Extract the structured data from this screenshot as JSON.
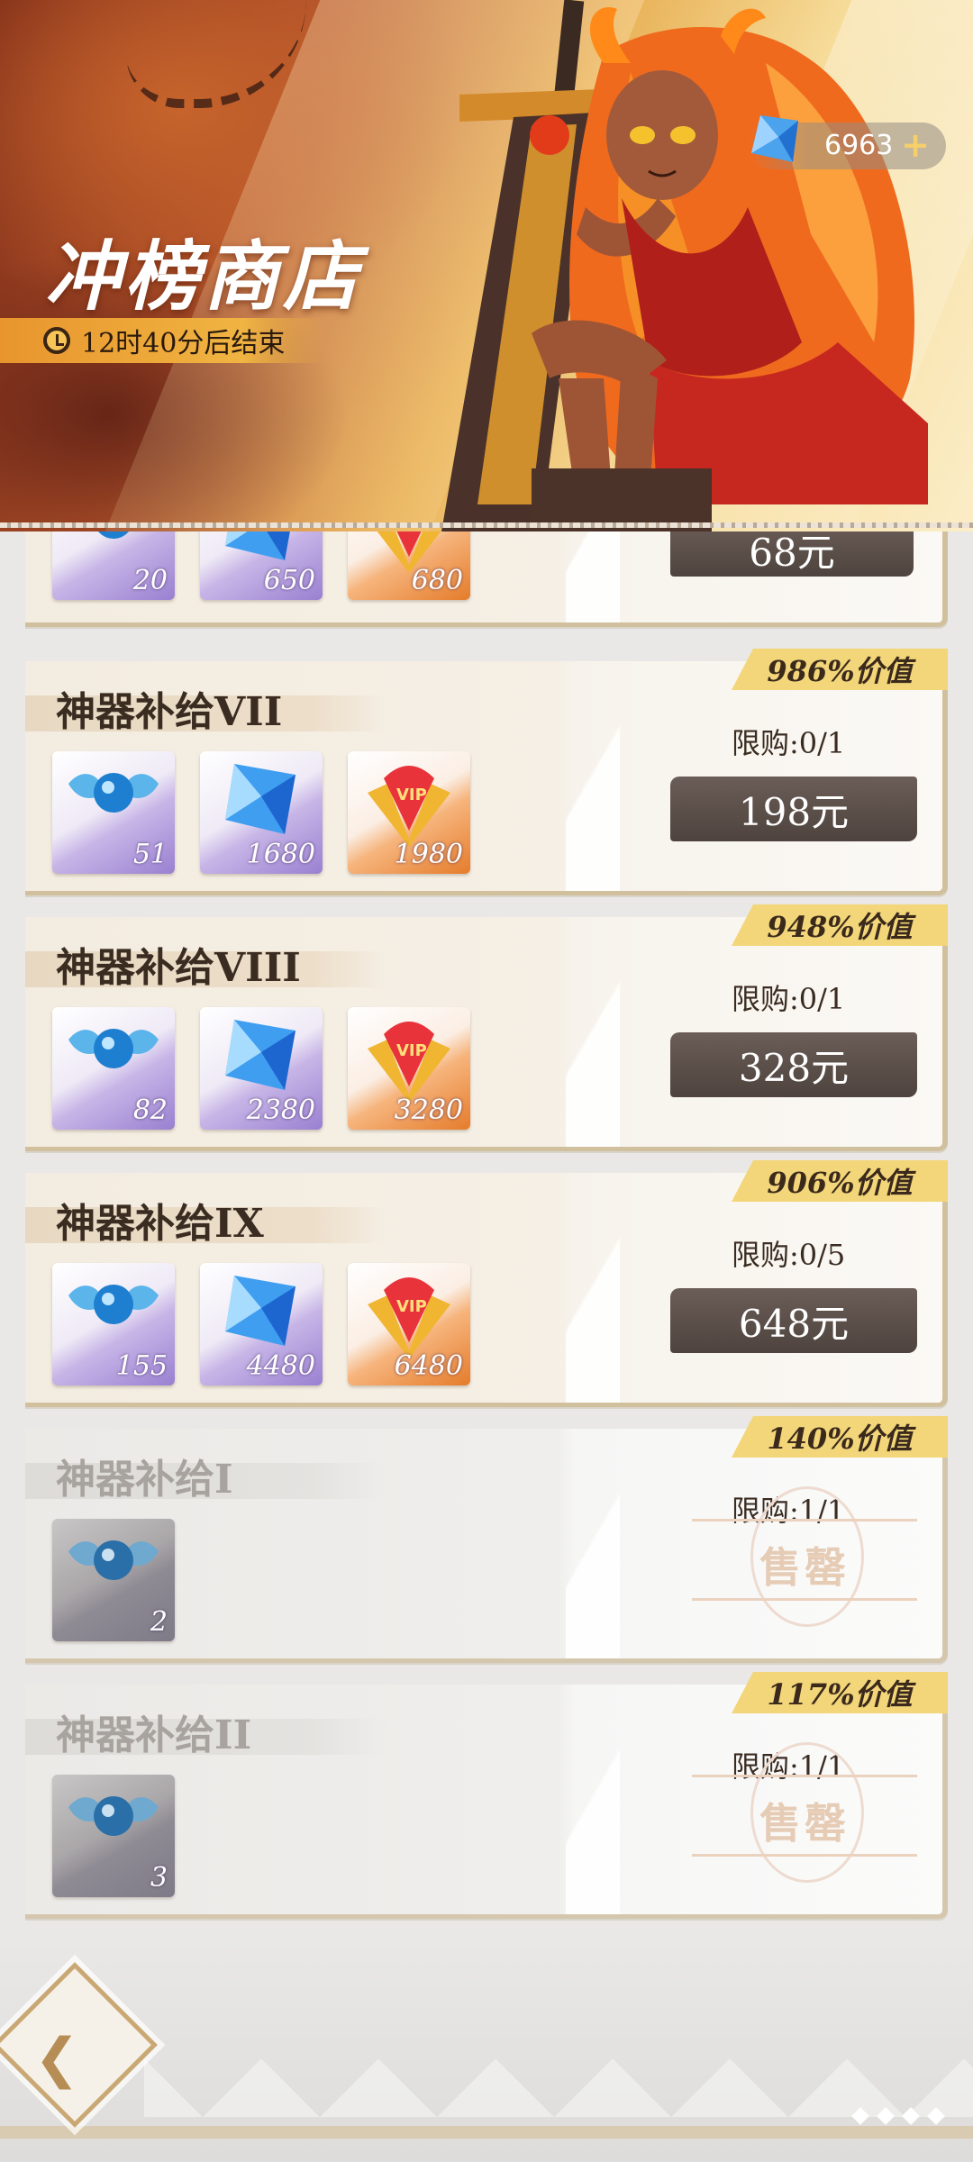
{
  "header": {
    "title": "冲榜商店",
    "timer": "12时40分后结束",
    "currency": {
      "icon": "blue-crystal-icon",
      "amount": "6963",
      "add_label": "+"
    }
  },
  "cards": [
    {
      "id": "partial",
      "button": "68元",
      "items": [
        {
          "icon": "winged-orb-icon",
          "count": "20",
          "rarity": "purple"
        },
        {
          "icon": "blue-crystal-icon",
          "count": "650",
          "rarity": "purple"
        },
        {
          "icon": "vip-badge-icon",
          "count": "680",
          "rarity": "orange"
        }
      ]
    },
    {
      "name": "神器补给VII",
      "value": "986%价值",
      "limit": "限购:0/1",
      "button": "198元",
      "items": [
        {
          "icon": "winged-orb-icon",
          "count": "51",
          "rarity": "purple"
        },
        {
          "icon": "blue-crystal-icon",
          "count": "1680",
          "rarity": "purple"
        },
        {
          "icon": "vip-badge-icon",
          "count": "1980",
          "rarity": "orange"
        }
      ]
    },
    {
      "name": "神器补给VIII",
      "value": "948%价值",
      "limit": "限购:0/1",
      "button": "328元",
      "items": [
        {
          "icon": "winged-orb-icon",
          "count": "82",
          "rarity": "purple"
        },
        {
          "icon": "blue-crystal-icon",
          "count": "2380",
          "rarity": "purple"
        },
        {
          "icon": "vip-badge-icon",
          "count": "3280",
          "rarity": "orange"
        }
      ]
    },
    {
      "name": "神器补给IX",
      "value": "906%价值",
      "limit": "限购:0/5",
      "button": "648元",
      "items": [
        {
          "icon": "winged-orb-icon",
          "count": "155",
          "rarity": "purple"
        },
        {
          "icon": "blue-crystal-icon",
          "count": "4480",
          "rarity": "purple"
        },
        {
          "icon": "vip-badge-icon",
          "count": "6480",
          "rarity": "orange"
        }
      ]
    },
    {
      "name": "神器补给I",
      "value": "140%价值",
      "limit": "限购:1/1",
      "soldout": "售罄",
      "items": [
        {
          "icon": "winged-orb-icon",
          "count": "2",
          "rarity": "grey"
        }
      ]
    },
    {
      "name": "神器补给II",
      "value": "117%价值",
      "limit": "限购:1/1",
      "soldout": "售罄",
      "items": [
        {
          "icon": "winged-orb-icon",
          "count": "3",
          "rarity": "grey"
        }
      ]
    }
  ],
  "footer": {
    "back_icon": "back-arrow-icon"
  },
  "colors": {
    "accent_gold": "#f2d679",
    "button_dark": "#5a4d47",
    "banner_orange": "#e8952d"
  }
}
